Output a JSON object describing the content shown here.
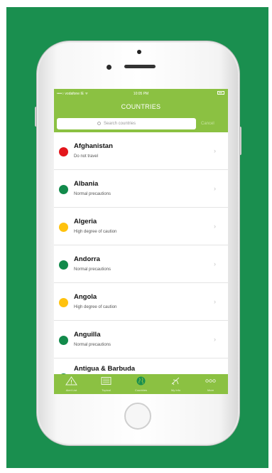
{
  "colors": {
    "background": "#1a8f4f",
    "accent": "#8bc142",
    "red": "#e3161c",
    "green": "#128a4b",
    "yellow": "#ffc20e"
  },
  "status": {
    "carrier": "••••○ vodafone IE ᯤ",
    "time": "10:05 PM"
  },
  "nav": {
    "title": "COUNTRIES"
  },
  "search": {
    "placeholder": "Search countries",
    "cancel": "Cancel"
  },
  "countries": [
    {
      "name": "Afghanistan",
      "advice": "Do not travel",
      "status": "red"
    },
    {
      "name": "Albania",
      "advice": "Normal precautions",
      "status": "green"
    },
    {
      "name": "Algeria",
      "advice": "High degree of caution",
      "status": "yellow"
    },
    {
      "name": "Andorra",
      "advice": "Normal precautions",
      "status": "green"
    },
    {
      "name": "Angola",
      "advice": "High degree of caution",
      "status": "yellow"
    },
    {
      "name": "Anguilla",
      "advice": "Normal precautions",
      "status": "green"
    },
    {
      "name": "Antigua & Barbuda",
      "advice": "",
      "status": "green"
    }
  ],
  "tabs": [
    {
      "label": "Alert List",
      "icon": "warning-icon"
    },
    {
      "label": "Topical",
      "icon": "news-icon"
    },
    {
      "label": "Countries",
      "icon": "globe-icon",
      "active": true
    },
    {
      "label": "My Info",
      "icon": "plane-icon"
    },
    {
      "label": "More",
      "icon": "more-icon"
    }
  ]
}
